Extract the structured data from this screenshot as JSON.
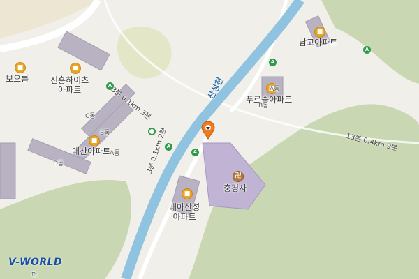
{
  "map": {
    "river_name": "산성천",
    "places": {
      "borem": "보오름",
      "jinheung": "진흥하이츠\n아파트",
      "daesan": "대산아파트",
      "namgo": "남고아파트",
      "prugeum": "푸르솔아파트",
      "chunggyeongsa": "충경사",
      "daeasan": "대아산성\n아파트"
    },
    "building_tags": {
      "c": "C동",
      "b": "B동",
      "a": "A동",
      "d": "D동",
      "a2": "A동",
      "b2": "B동"
    },
    "route_labels": {
      "left_trail": "3분 0.1km 3분",
      "center_trail": "3분 0.1km 2분",
      "right_trail": "13분 0.4km 9분"
    },
    "icons": {
      "apartment": "apartment-icon",
      "temple": "temple-icon",
      "trail_marker": "trail-marker-icon",
      "location_pin": "location-pin-icon"
    },
    "colors": {
      "river": "#8fc3e0",
      "forest": "#c9d8b2",
      "building": "#b9b2c2",
      "poi": "#e8a623",
      "marker": "#f07b1e",
      "trail": "#2e9a4a"
    },
    "logo": "V-WORLD",
    "bottom_text": "퍼"
  }
}
